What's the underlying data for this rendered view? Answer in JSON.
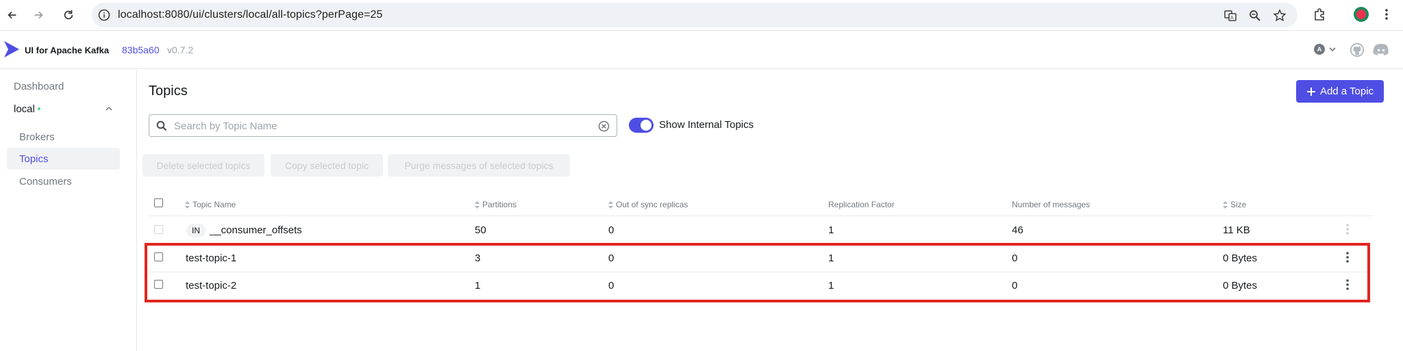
{
  "browser": {
    "url": "localhost:8080/ui/clusters/local/all-topics?perPage=25"
  },
  "app": {
    "brand": "UI for Apache Kafka",
    "commit": "83b5a60",
    "version": "v0.7.2",
    "user_initial": "A"
  },
  "sidebar": {
    "dashboard": "Dashboard",
    "cluster": "local",
    "items": [
      {
        "label": "Brokers"
      },
      {
        "label": "Topics"
      },
      {
        "label": "Consumers"
      }
    ]
  },
  "main": {
    "title": "Topics",
    "add_button": "Add a Topic",
    "search_placeholder": "Search by Topic Name",
    "toggle_label": "Show Internal Topics",
    "bulk_actions": [
      "Delete selected topics",
      "Copy selected topic",
      "Purge messages of selected topics"
    ]
  },
  "table": {
    "columns": [
      "Topic Name",
      "Partitions",
      "Out of sync replicas",
      "Replication Factor",
      "Number of messages",
      "Size"
    ],
    "internal_badge": "IN",
    "rows": [
      {
        "name": "__consumer_offsets",
        "partitions": "50",
        "out_of_sync": "0",
        "replication": "1",
        "messages": "46",
        "size": "11 KB"
      },
      {
        "name": "test-topic-1",
        "partitions": "3",
        "out_of_sync": "0",
        "replication": "1",
        "messages": "0",
        "size": "0 Bytes"
      },
      {
        "name": "test-topic-2",
        "partitions": "1",
        "out_of_sync": "0",
        "replication": "1",
        "messages": "0",
        "size": "0 Bytes"
      }
    ]
  },
  "colors": {
    "accent": "#4f4ee4",
    "highlight": "#e0261f",
    "status_online": "#5cd685"
  }
}
